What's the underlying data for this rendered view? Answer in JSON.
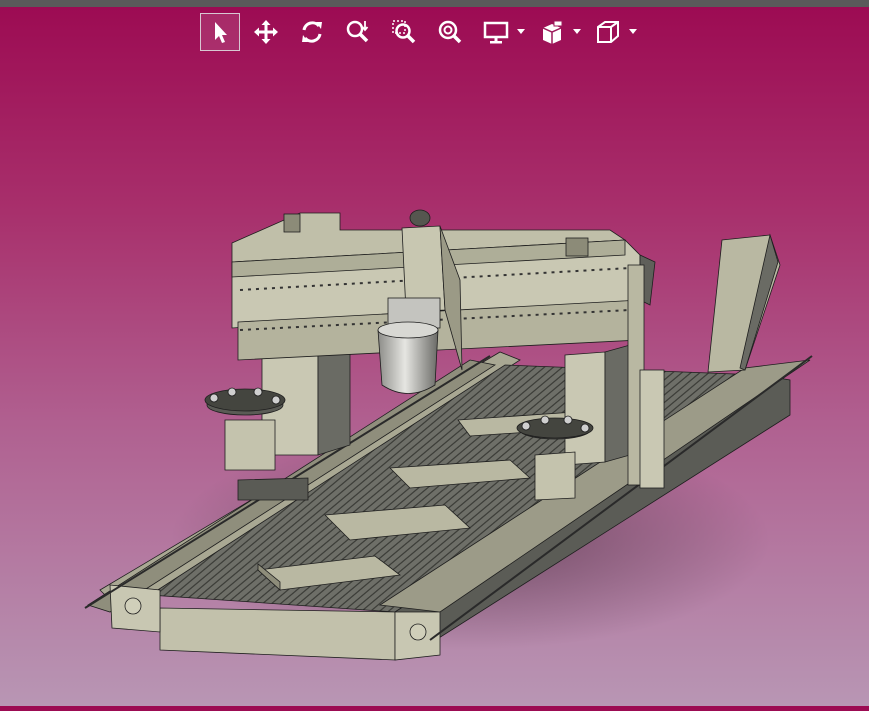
{
  "toolbar": {
    "buttons": [
      {
        "id": "select",
        "icon": "arrow-pointer-icon",
        "active": true
      },
      {
        "id": "pan",
        "icon": "move-arrows-icon"
      },
      {
        "id": "rotate",
        "icon": "rotate-icon"
      },
      {
        "id": "zoom",
        "icon": "zoom-icon"
      },
      {
        "id": "zoom-window",
        "icon": "zoom-window-icon"
      },
      {
        "id": "zoom-fit",
        "icon": "zoom-fit-icon"
      },
      {
        "id": "display",
        "icon": "monitor-icon",
        "dropdown": true
      },
      {
        "id": "section",
        "icon": "section-cube-icon",
        "dropdown": true
      },
      {
        "id": "view",
        "icon": "cube-icon",
        "dropdown": true
      }
    ]
  },
  "colors": {
    "background_top": "#9c0a52",
    "background_bottom": "#b896b4",
    "model_fill": "#b9b8a2",
    "model_dark": "#5f605a",
    "model_edge": "#1e1e1e"
  },
  "viewport": {
    "model": "gantry-milling-machine"
  }
}
